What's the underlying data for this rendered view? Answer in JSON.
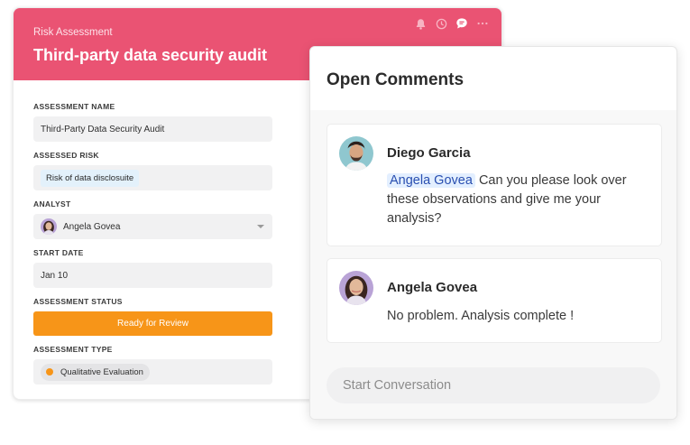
{
  "card": {
    "eyebrow": "Risk Assessment",
    "title": "Third-party data security audit",
    "header_icons": [
      "bell-icon",
      "clock-icon",
      "chat-icon",
      "more-icon"
    ],
    "accent_color": "#ea5373"
  },
  "form": {
    "assessment_name": {
      "label": "ASSESSMENT NAME",
      "value": "Third-Party Data Security Audit"
    },
    "assessed_risk": {
      "label": "ASSESSED RISK",
      "value": "Risk of data disclosuite"
    },
    "analyst": {
      "label": "ANALYST",
      "value": "Angela Govea"
    },
    "start_date": {
      "label": "START DATE",
      "value": "Jan 10"
    },
    "assessment_status": {
      "label": "ASSESSMENT STATUS",
      "value": "Ready for Review",
      "color": "#f79518"
    },
    "assessment_type": {
      "label": "ASSESSMENT TYPE",
      "value": "Qualitative Evaluation"
    }
  },
  "comments_panel": {
    "title": "Open Comments",
    "comments": [
      {
        "author": "Diego Garcia",
        "mention": "Angela Govea",
        "text": "Can you please look over these observations and give me your analysis?"
      },
      {
        "author": "Angela Govea",
        "mention": "",
        "text": "No problem. Analysis complete !"
      }
    ],
    "input_placeholder": "Start Conversation"
  }
}
